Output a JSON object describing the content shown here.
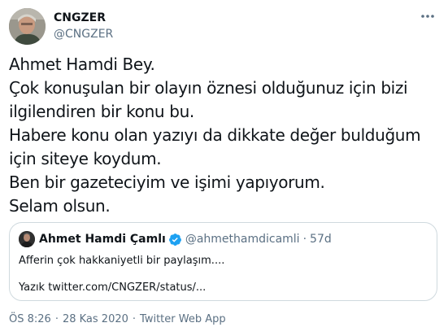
{
  "author": {
    "name": "CNGZER",
    "handle": "@CNGZER"
  },
  "tweet": {
    "lines": [
      "Ahmet Hamdi Bey.",
      "Çok konuşulan bir olayın öznesi olduğunuz için bizi",
      "ilgilendiren bir konu bu.",
      "Habere konu olan yazıyı da dikkate değer bulduğum",
      "için siteye koydum.",
      "Ben bir gazeteciyim ve işimi yapıyorum.",
      "Selam olsun."
    ]
  },
  "quote": {
    "name": "Ahmet Hamdi Çamlı",
    "handle": "@ahmethamdicamli",
    "separator": "·",
    "time": "57d",
    "line1": "Afferin çok hakkaniyetli bir paylaşım....",
    "line2": "Yazık twitter.com/CNGZER/status/..."
  },
  "meta": {
    "time": "ÖS 8:26",
    "dot1": "·",
    "date": "28 Kas 2020",
    "dot2": "·",
    "source": "Twitter Web App"
  },
  "colors": {
    "text": "#0f1419",
    "secondary": "#5b7083",
    "verified": "#1da1f2",
    "border": "#cfd9de"
  },
  "icons": {
    "more": "more-horizontal-icon",
    "verified": "verified-badge-icon"
  }
}
